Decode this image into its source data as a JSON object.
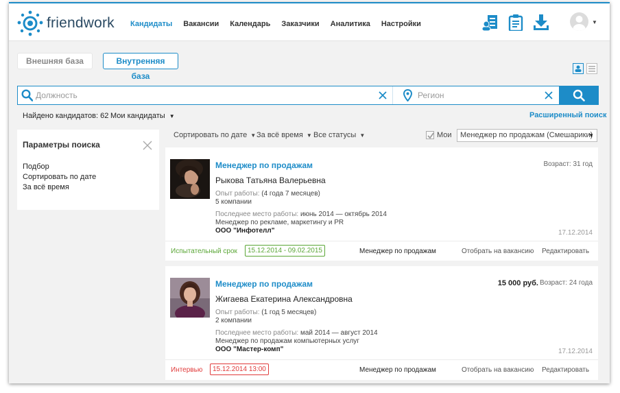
{
  "app": {
    "logo_text": "friendwork",
    "nav": [
      "Кандидаты",
      "Вакансии",
      "Календарь",
      "Заказчики",
      "Аналитика",
      "Настройки"
    ],
    "active_nav": "Кандидаты",
    "toolbar_icons": [
      "add-candidate-icon",
      "clipboard-icon",
      "download-icon"
    ],
    "accent": "#1d8cc8"
  },
  "tabs": {
    "external": "Внешняя база",
    "internal": "Внутренняя база",
    "active": "internal"
  },
  "search": {
    "position_placeholder": "Должность",
    "region_placeholder": "Регион"
  },
  "summary": {
    "found": "Найдено кандидатов: 62",
    "my_candidates": "Мои кандидаты",
    "advanced": "Расширенный поиск"
  },
  "params": {
    "title": "Параметры поиска",
    "items": [
      "Подбор",
      "Сортировать по дате",
      "За всё время"
    ]
  },
  "filters": {
    "sort": "Сортировать по дате",
    "period": "За всё время",
    "statuses": "Все статусы",
    "mine_label": "Мои",
    "mine_checked": true,
    "manager_select": "Менеджер по продажам (Смешарики)"
  },
  "candidates": [
    {
      "job": "Менеджер по продажам",
      "name": "Рыкова Татьяна Валерьевна",
      "age": "Возраст: 31 год",
      "salary": "",
      "exp_label": "Опыт работы:",
      "exp_value": "(4 года 7 месяцев)",
      "companies": "5 компании",
      "last_label": "Последнее место работы:",
      "last_period": "июнь 2014 — октябрь 2014",
      "last_position": "Менеджер по рекламе, маркетингу и PR",
      "last_company": "ООО \"Инфотелл\"",
      "date": "17.12.2014",
      "status": "Испытательный срок",
      "status_color": "#5aa636",
      "period": "15.12.2014 - 09.02.2015",
      "vacancy": "Менеджер по продажам",
      "pick": "Отобрать на вакансию",
      "edit": "Редактировать"
    },
    {
      "job": "Менеджер по продажам",
      "name": "Жигаева Екатерина Александровна",
      "age": "Возраст: 24 года",
      "salary": "15 000 руб.",
      "exp_label": "Опыт работы:",
      "exp_value": "(1 год 5 месяцев)",
      "companies": "2 компании",
      "last_label": "Последнее место работы:",
      "last_period": "май 2014 — август 2014",
      "last_position": "Менеджер по продажам компьютерных услуг",
      "last_company": "ООО \"Мастер-комп\"",
      "date": "17.12.2014",
      "status": "Интервью",
      "status_color": "#e03a3a",
      "period": "15.12.2014 13:00",
      "vacancy": "Менеджер по продажам",
      "pick": "Отобрать на вакансию",
      "edit": "Редактировать"
    }
  ]
}
